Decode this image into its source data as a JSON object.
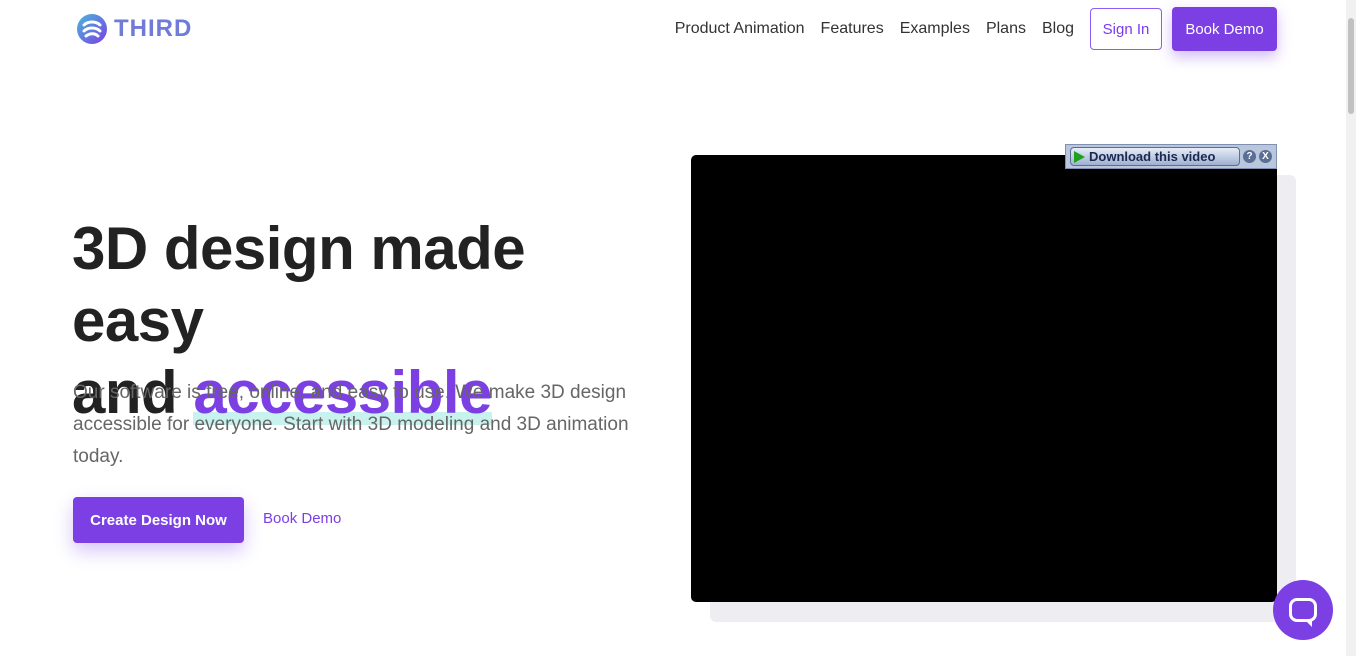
{
  "header": {
    "logo_text": "THIRD",
    "nav": [
      "Product Animation",
      "Features",
      "Examples",
      "Plans",
      "Blog"
    ],
    "signin_label": "Sign In",
    "book_demo_label": "Book Demo"
  },
  "hero": {
    "title_line1": "3D design made easy",
    "title_and": "and",
    "title_accent": "accessible",
    "description": "Our software is free, online, and easy to use. We make 3D design accessible for everyone. Start with 3D modeling and 3D animation today.",
    "cta_primary": "Create Design Now",
    "cta_secondary": "Book Demo"
  },
  "video_overlay": {
    "download_label": "Download this video",
    "help_label": "?",
    "close_label": "X"
  },
  "colors": {
    "accent": "#7b3fe4",
    "highlight": "#c8f2ee",
    "logo": "#6f7bd6"
  },
  "icons": {
    "logo": "third-logo-icon",
    "play": "play-icon",
    "chat": "chat-icon"
  }
}
